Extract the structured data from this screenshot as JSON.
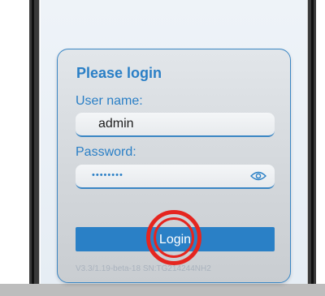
{
  "login": {
    "title": "Please login",
    "username_label": "User name:",
    "username_value": "admin",
    "password_label": "Password:",
    "password_masked": "••••••••",
    "button_label": "Login",
    "version": "V3.3/1.19-beta-18 SN:TG214244NH2"
  },
  "icons": {
    "password_toggle": "eye-icon"
  },
  "colors": {
    "accent": "#2a80c6",
    "highlight_ring": "#e5251f"
  }
}
